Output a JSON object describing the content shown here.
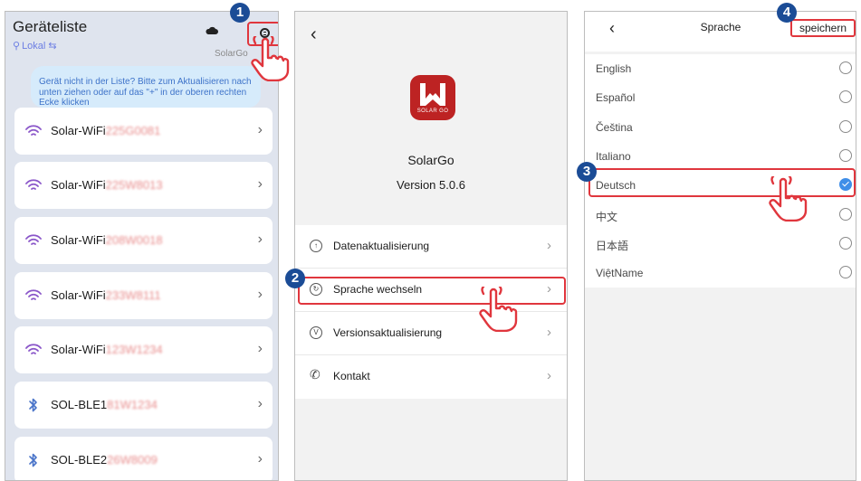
{
  "colors": {
    "highlight": "#e0363d",
    "badge": "#1b4c96",
    "panel1_bg": "#dfe4ee",
    "hint_bg": "#d6ebfb",
    "hint_text": "#3e73c9",
    "accent_blue": "#3f8ee8",
    "logo_red": "#bd2323"
  },
  "steps": [
    "1",
    "2",
    "3",
    "4"
  ],
  "device_list": {
    "title": "Geräteliste",
    "location": "Lokal",
    "location_icon": "location-pin-icon",
    "link_icon": "swap-arrows-icon",
    "brand": "SolarGo",
    "hint": "Gerät nicht in der Liste? Bitte zum Aktualisieren nach unten ziehen oder auf das \"+\" in der oberen rechten Ecke klicken",
    "devices": [
      {
        "prefix": "Solar-WiFi",
        "serial": "225G0081",
        "icon": "wifi-icon"
      },
      {
        "prefix": "Solar-WiFi",
        "serial": "225W8013",
        "icon": "wifi-icon"
      },
      {
        "prefix": "Solar-WiFi",
        "serial": "208W0018",
        "icon": "wifi-icon"
      },
      {
        "prefix": "Solar-WiFi",
        "serial": "233W8111",
        "icon": "wifi-icon"
      },
      {
        "prefix": "Solar-WiFi",
        "serial": "123W1234",
        "icon": "wifi-icon"
      },
      {
        "prefix": "SOL-BLE1",
        "serial": "81W1234",
        "icon": "bluetooth-icon"
      },
      {
        "prefix": "SOL-BLE2",
        "serial": "26W8009",
        "icon": "bluetooth-icon"
      }
    ]
  },
  "about": {
    "logo_text": "SOLAR GO",
    "app_name": "SolarGo",
    "version": "Version 5.0.6",
    "items": [
      {
        "label": "Datenaktualisierung",
        "icon": "upload-arrow-icon"
      },
      {
        "label": "Sprache wechseln",
        "icon": "language-switch-icon"
      },
      {
        "label": "Versionsaktualisierung",
        "icon": "version-icon"
      },
      {
        "label": "Kontakt",
        "icon": "phone-icon"
      }
    ]
  },
  "language": {
    "title": "Sprache",
    "save": "speichern",
    "selected": "Deutsch",
    "options": [
      "English",
      "Español",
      "Čeština",
      "Italiano",
      "Deutsch",
      "中文",
      "日本語",
      "ViệtName"
    ]
  }
}
